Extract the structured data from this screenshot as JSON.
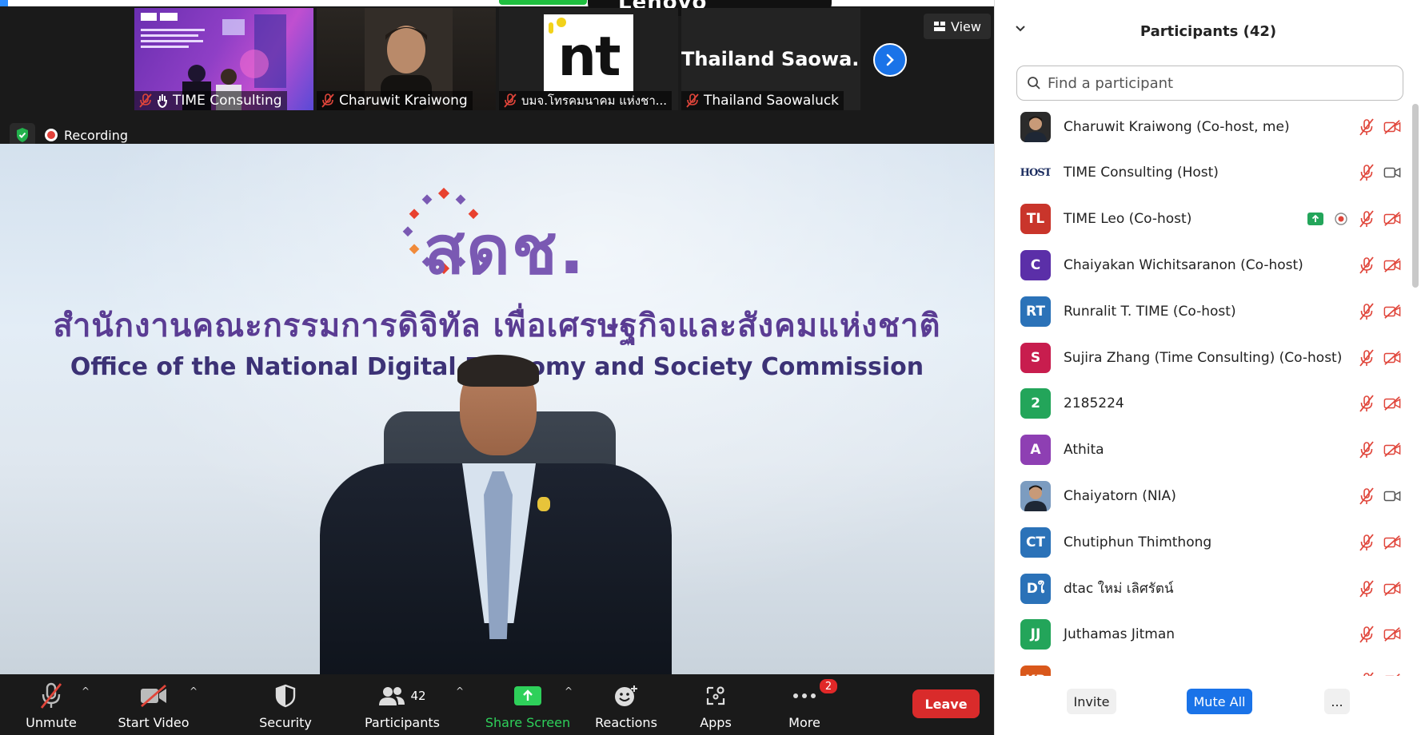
{
  "meeting": {
    "top_brand": "Lenovo",
    "view_label": "View",
    "recording_label": "Recording",
    "thumbnails": [
      {
        "name": "TIME Consulting",
        "kind": "slide"
      },
      {
        "name": "Charuwit Kraiwong",
        "kind": "camera"
      },
      {
        "name": "บมจ.โทรคมนาคม แห่งชา...",
        "kind": "logo",
        "logo_text": "nt"
      },
      {
        "name": "Thailand Saowaluck",
        "kind": "name",
        "big_name": "Thailand Saowa..."
      }
    ],
    "video": {
      "logo_text": "สดช.",
      "org_thai": "สำนักงานคณะกรรมการดิจิทัล เพื่อเศรษฐกิจและสังคมแห่งชาติ",
      "org_en": "Office of the National Digital Economy and Society Commission"
    }
  },
  "toolbar": {
    "unmute": "Unmute",
    "start_video": "Start Video",
    "security": "Security",
    "participants": "Participants",
    "participants_count": "42",
    "share_screen": "Share Screen",
    "reactions": "Reactions",
    "apps": "Apps",
    "more": "More",
    "more_badge": "2",
    "leave": "Leave"
  },
  "panel": {
    "title": "Participants (42)",
    "search_placeholder": "Find a participant",
    "participants": [
      {
        "name": "Charuwit Kraiwong (Co-host, me)",
        "avatar": "photo",
        "color": "#2b2b2b",
        "initials": "",
        "video": "off",
        "extra": ""
      },
      {
        "name": "TIME Consulting (Host)",
        "avatar": "host-logo",
        "color": "#ffffff",
        "initials": "HOST",
        "video": "on",
        "extra": ""
      },
      {
        "name": "TIME Leo (Co-host)",
        "avatar": "initials",
        "color": "#c9352b",
        "initials": "TL",
        "video": "off",
        "extra": "share-and-record"
      },
      {
        "name": "Chaiyakan Wichitsaranon (Co-host)",
        "avatar": "initials",
        "color": "#5b2fa8",
        "initials": "C",
        "video": "off",
        "extra": ""
      },
      {
        "name": "Runralit T. TIME (Co-host)",
        "avatar": "initials",
        "color": "#2b72b8",
        "initials": "RT",
        "video": "off",
        "extra": ""
      },
      {
        "name": "Sujira Zhang (Time Consulting) (Co-host)",
        "avatar": "initials",
        "color": "#c81d4e",
        "initials": "S",
        "video": "off",
        "extra": ""
      },
      {
        "name": "2185224",
        "avatar": "initials",
        "color": "#23a55a",
        "initials": "2",
        "video": "off",
        "extra": ""
      },
      {
        "name": "Athita",
        "avatar": "initials",
        "color": "#8e3fb3",
        "initials": "A",
        "video": "off",
        "extra": ""
      },
      {
        "name": "Chaiyatorn (NIA)",
        "avatar": "photo",
        "color": "#7c9cc0",
        "initials": "",
        "video": "on",
        "extra": ""
      },
      {
        "name": "Chutiphun Thimthong",
        "avatar": "initials",
        "color": "#2b72b8",
        "initials": "CT",
        "video": "off",
        "extra": ""
      },
      {
        "name": "dtac ใหม่ เลิศรัตน์",
        "avatar": "initials",
        "color": "#2b72b8",
        "initials": "Dใ",
        "video": "off",
        "extra": ""
      },
      {
        "name": "Juthamas Jitman",
        "avatar": "initials",
        "color": "#23a55a",
        "initials": "JJ",
        "video": "off",
        "extra": ""
      },
      {
        "name": "",
        "avatar": "initials",
        "color": "#d9581b",
        "initials": "KR",
        "video": "off",
        "extra": ""
      }
    ],
    "invite": "Invite",
    "mute_all": "Mute All",
    "more": "..."
  },
  "colors": {
    "accent_blue": "#1a73e8",
    "share_green": "#2ed05a",
    "leave_red": "#d92b2b",
    "muted_red": "#e0453a"
  }
}
